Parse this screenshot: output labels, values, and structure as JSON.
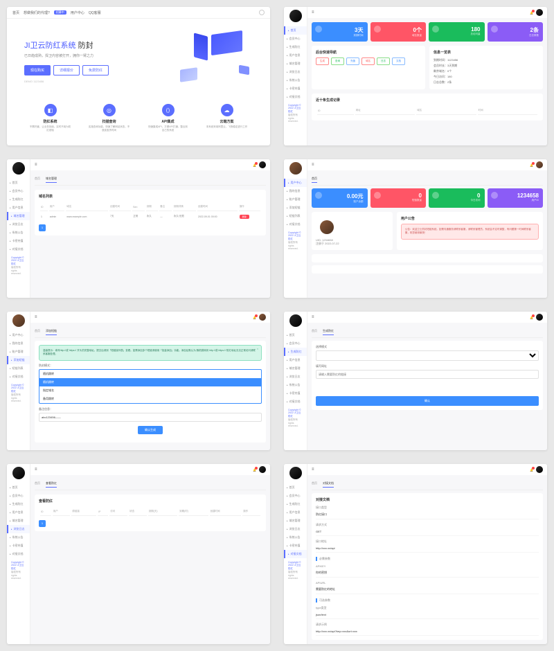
{
  "s1": {
    "nav": [
      "首页",
      "想做我们的代理?",
      "用户中心",
      "QQ客服"
    ],
    "beta": "招募中",
    "title_a": "JI卫云防红系统",
    "title_b": "防封",
    "sub": "已日趋成熟，捍卫内容被打开，拥你一臂之力",
    "btns": [
      "现在购买",
      "详细报价",
      "免费防红"
    ],
    "demo": "DEMO 1123456",
    "features": [
      {
        "ico": "◧",
        "t": "防红系统",
        "d": "不需托管，让业务持续。实时不用为防红烦恼"
      },
      {
        "ico": "◎",
        "t": "扫描查询",
        "d": "实施查询功能，快速了解网站状态，不浪费宝贵时间"
      },
      {
        "ico": "⟨⟩",
        "t": "API集成",
        "d": "快速集成API，方便API打通，整合到自己的系统"
      },
      {
        "ico": "☁",
        "t": "云端方案",
        "d": "本系统采用阿里云，飞快稳定进行工作"
      }
    ]
  },
  "s2": {
    "sidebar": [
      "首页",
      "会员中心",
      "生成防红",
      "用户信息",
      "域名管理",
      "浏览日志",
      "系统公告",
      "卡密充值",
      "对接文档"
    ],
    "stats": [
      {
        "n": "3天",
        "l": "到期时间"
      },
      {
        "n": "0个",
        "l": "域名数量"
      },
      {
        "n": "180",
        "l": "总访问量"
      },
      {
        "n": "2条",
        "l": "日志条数"
      }
    ],
    "quick_t": "后台快速导航",
    "quick": [
      [
        "生成",
        "查询",
        "充值"
      ],
      [
        "域名",
        "日志",
        "文档"
      ]
    ],
    "info_t": "信息一览表",
    "info": [
      "到期时间：1123456",
      "会员时长：3天到期",
      "剩余域名：0个",
      "今日访问：180",
      "日志总数：2条"
    ],
    "recent_t": "近十条生成记录",
    "recent_cols": [
      "ID",
      "网址",
      "域名",
      "时间"
    ]
  },
  "s3": {
    "sidebar": [
      "首页",
      "会员中心",
      "生成防红",
      "用户信息",
      "域名管理",
      "浏览日志",
      "系统公告",
      "卡密充值",
      "对接文档"
    ],
    "tabs": [
      "首页",
      "域名管理"
    ],
    "panel_t": "域名列表",
    "cols": [
      "ID",
      "用户",
      "域名",
      "创建时间",
      "Ban",
      "到期",
      "备注",
      "到期详情",
      "创建时间",
      "操作"
    ],
    "row": [
      "1",
      "admin",
      "www.example.com",
      "7天",
      "正常",
      "永久",
      "—",
      "永久/无限",
      "2022-09-01 00:00",
      "删除"
    ]
  },
  "s4": {
    "sidebar": [
      "用户中心",
      "我的信息",
      "账户管理",
      "添加短链",
      "短链列表",
      "对接文档"
    ],
    "stats": [
      {
        "n": "0.00元",
        "l": "账户余额"
      },
      {
        "n": "0",
        "l": "短链数量"
      },
      {
        "n": "0",
        "l": "今日访问"
      },
      {
        "n": "1234658",
        "l": "用户ID"
      }
    ],
    "uid": "UID: 1234658",
    "join": "注册于 2022-07-22",
    "notice_t": "用户公告",
    "notice": "公告：欢迎卫士防封短链系统。如需沟通服务请联系客服，请联系管理员。系统会不定时调整，有问题第一时间联系客服，祝您使用愉快！",
    "tabs": [
      "首页"
    ]
  },
  "s5": {
    "sidebar": [
      "用户中心",
      "我的信息",
      "账户管理",
      "添加短链",
      "短链列表",
      "对接文档"
    ],
    "tabs": [
      "首页",
      "添加短链"
    ],
    "alert": "温馨提示：填写http://或 https:// 开头的完整地址。提交后请到「短链接列表」查看。如需添加多个短链请使用「批量添加」功能。添加后默认为 随机跳转到 http://或 https:// 防红地址无法正常访问请联系客服处理。",
    "mode_l": "防封模式：",
    "mode_v": "随机跳转",
    "opts": [
      "随机跳转",
      "指定域名",
      "备用跳转"
    ],
    "memo_l": "备注信息：",
    "memo_v": "abc123456——",
    "submit": "确认生成"
  },
  "s6": {
    "sidebar": [
      "首页",
      "会员中心",
      "生成防红",
      "用户信息",
      "域名管理",
      "浏览日志",
      "系统公告",
      "卡密充值",
      "对接文档"
    ],
    "tabs": [
      "首页",
      "生成防红"
    ],
    "l1": "选择模式",
    "l2": "填写网址",
    "ph": "请输入需要防红的链接",
    "submit": "确认"
  },
  "s7": {
    "sidebar": [
      "首页",
      "会员中心",
      "生成防红",
      "用户信息",
      "域名管理",
      "浏览日志",
      "系统公告",
      "卡密充值",
      "对接文档"
    ],
    "tabs": [
      "首页",
      "查看防红"
    ],
    "panel_t": "查看防红",
    "cols": [
      "ID",
      "用户",
      "原链接",
      "IP",
      "访问",
      "状态",
      "到期(天)",
      "到期(时)",
      "创建时间",
      "操作"
    ]
  },
  "s8": {
    "sidebar": [
      "首页",
      "会员中心",
      "生成防红",
      "用户信息",
      "域名管理",
      "浏览日志",
      "系统公告",
      "卡密充值",
      "对接文档"
    ],
    "tabs": [
      "首页",
      "对接文档"
    ],
    "t": "对接文档",
    "rows": [
      [
        "接口类型",
        "防红接口"
      ],
      [
        "请求方式",
        "GET"
      ],
      [
        "接口地址",
        "http://xxx.xx/api"
      ],
      [
        "必需参数",
        ""
      ],
      [
        "APIKEY",
        "你的密钥"
      ],
      [
        "APIURL",
        "需要防红的地址"
      ],
      [
        "可选参数",
        ""
      ],
      [
        "type类型",
        "json/text"
      ],
      [
        "请求示例",
        "http://xxx.xx/api?key=xxx&url=xxx"
      ]
    ]
  },
  "foot": {
    "a": "Copyright © 2022",
    "b": "JI卫云防红",
    "c": "版权所有 rights reserved."
  }
}
